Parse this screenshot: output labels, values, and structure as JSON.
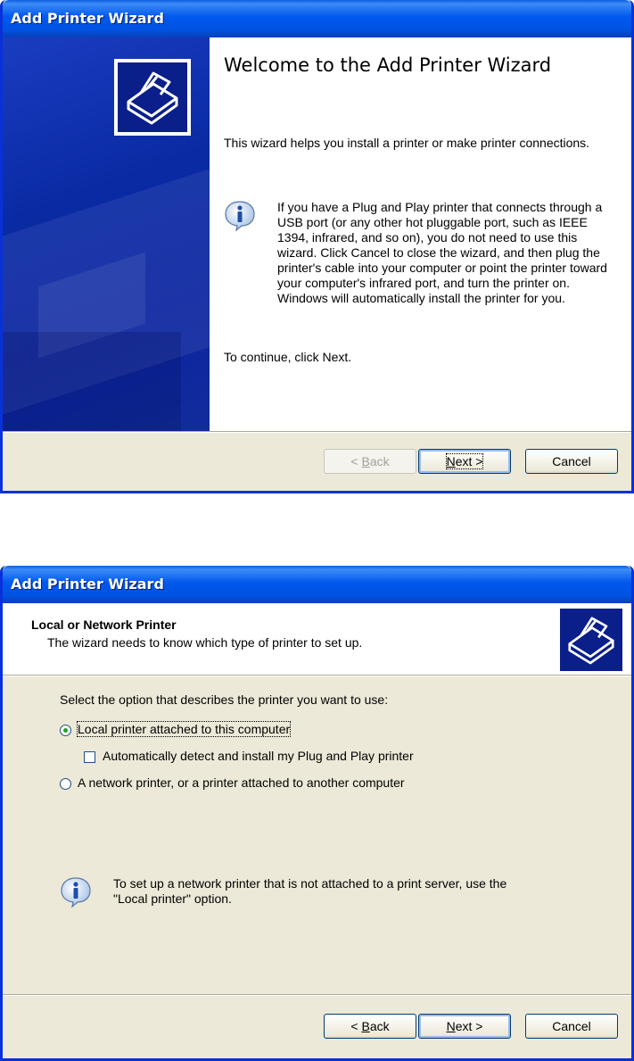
{
  "window1": {
    "title": "Add Printer Wizard",
    "heading": "Welcome to the Add Printer Wizard",
    "intro": "This wizard helps you install a printer or make printer connections.",
    "info_text": "If you have a Plug and Play printer that connects through a USB port (or any other hot pluggable port, such as IEEE 1394, infrared, and so on), you do not need to use this wizard. Click Cancel to close the wizard, and then plug the printer's cable into your computer or point the printer toward your computer's infrared port, and turn the printer on. Windows will automatically install the printer for you.",
    "continue_text": "To continue, click Next.",
    "buttons": {
      "back": {
        "pre": "< ",
        "key": "B",
        "post": "ack"
      },
      "next": {
        "key": "N",
        "post": "ext >"
      },
      "cancel": "Cancel"
    }
  },
  "window2": {
    "title": "Add Printer Wizard",
    "header_title": "Local or Network Printer",
    "header_subtitle": "The wizard needs to know which type of printer to set up.",
    "prompt": "Select the option that describes the printer you want to use:",
    "options": {
      "local": {
        "key": "L",
        "post": "ocal printer attached to this computer",
        "selected": true
      },
      "autodetect": {
        "key": "A",
        "post": "utomatically detect and install my Plug and Play printer",
        "checked": false
      },
      "network": {
        "pre": "A ",
        "key": "n",
        "post": "etwork printer, or a printer attached to another computer",
        "selected": false
      }
    },
    "info_text": "To set up a network printer that is not attached to a print server, use the \"Local printer\" option.",
    "buttons": {
      "back": {
        "pre": "< ",
        "key": "B",
        "post": "ack"
      },
      "next": {
        "key": "N",
        "post": "ext >"
      },
      "cancel": "Cancel"
    }
  },
  "icons": [
    "printer-wizard-icon",
    "info-icon",
    "radio-button",
    "checkbox"
  ],
  "colors": {
    "titlebar": "#0058ee",
    "dialog_bg": "#ece9d8",
    "side_panel": "#0a2aa4"
  }
}
